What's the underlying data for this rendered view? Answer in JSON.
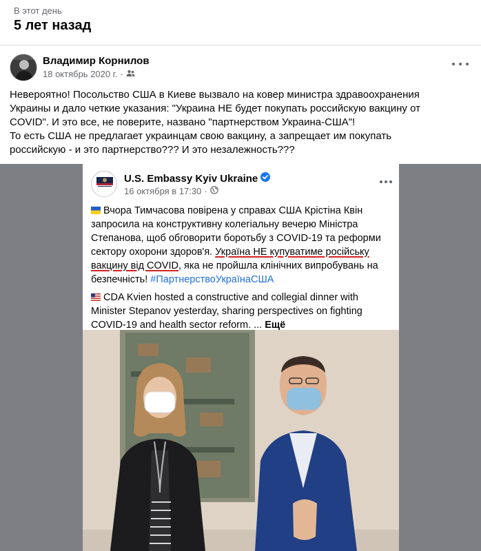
{
  "memory": {
    "label": "В этот день",
    "title": "5 лет назад"
  },
  "post": {
    "author": "Владимир Корнилов",
    "date": "18 октябрь 2020 г.",
    "separator": "·",
    "audience_icon": "friends-icon",
    "text_lines": [
      "Невероятно! Посольство США в Киеве вызвало на ковер министра здравоохранения",
      "Украины и дало четкие указания: \"Украина НЕ будет покупать российскую вакцину от",
      "COVID\". И это все, не поверите, названо \"партнерством Украина-США\"!",
      "То есть США не предлагает украинцам свою вакцину, а запрещает им покупать",
      "российскую - и это партнерство??? И это незалежность???"
    ]
  },
  "shared_post": {
    "author": "U.S. Embassy Kyiv Ukraine",
    "date": "16 октября в 17:30",
    "separator": "·",
    "logo_text_top": "U.S. EMBASSY",
    "logo_text_bottom": "Ukraine",
    "ua_text_start": "Вчора Тимчасова повірена у справах США Крістіна Квін запросила на конструктивну колегіальну вечерю Міністра Степанова, щоб обговорити боротьбу з COVID-19 та реформи сектору охорони здоров'я. ",
    "ua_text_underlined": "Україна НЕ купуватиме російську вакцину від COVID",
    "ua_text_end": ", яка не пройшла клінічних випробувань на безпечність! ",
    "hashtag": "#ПартнерствоУкраїнаСША",
    "en_text": "CDA Kvien hosted a constructive and collegial dinner with Minister Stepanov yesterday, sharing perspectives on fighting COVID-19 and health sector reform. ... ",
    "more_label": "Ещё"
  },
  "colors": {
    "link": "#216fdb",
    "verified": "#1877f2",
    "underline": "#d52020",
    "secondary_text": "#65676b"
  }
}
